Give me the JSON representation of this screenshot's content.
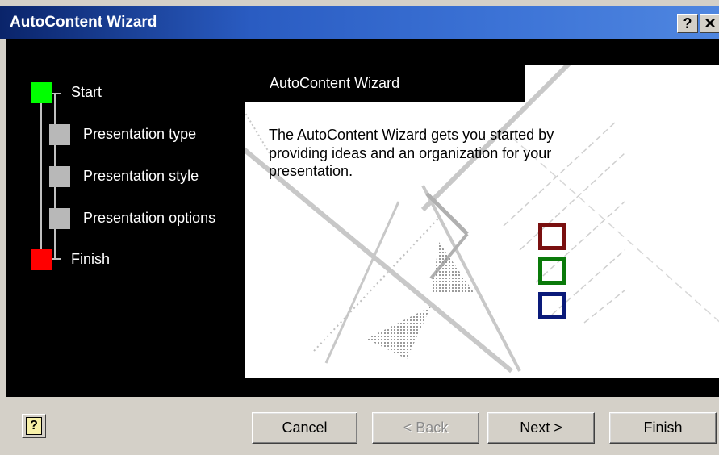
{
  "window": {
    "title": "AutoContent Wizard",
    "help_glyph": "?",
    "close_glyph": "✕"
  },
  "steps": [
    {
      "label": "Start",
      "color": "#00ff00"
    },
    {
      "label": "Presentation type",
      "color": "#b8b8b8"
    },
    {
      "label": "Presentation style",
      "color": "#b8b8b8"
    },
    {
      "label": "Presentation options",
      "color": "#b8b8b8"
    },
    {
      "label": "Finish",
      "color": "#ff0000"
    }
  ],
  "panel": {
    "header": "AutoContent Wizard",
    "description": "The AutoContent Wizard gets you started by providing ideas and an organization for your presentation."
  },
  "decor_squares": [
    "#7a1010",
    "#0a7a0a",
    "#0a1a7a"
  ],
  "buttons": {
    "cancel": "Cancel",
    "back": "< Back",
    "next": "Next >",
    "finish": "Finish",
    "help_icon": "?"
  },
  "icons": {
    "help": "help-book-icon",
    "close": "close-icon"
  }
}
